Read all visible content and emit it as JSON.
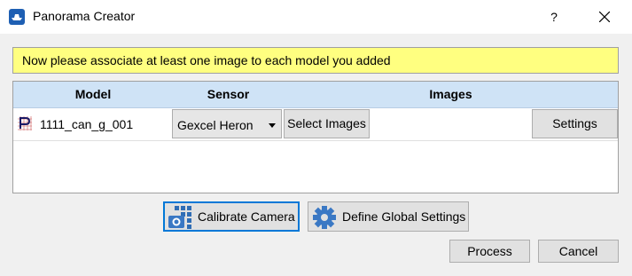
{
  "window": {
    "title": "Panorama Creator",
    "help_label": "?",
    "app_icon": "boat-app-icon",
    "close_icon": "close-icon"
  },
  "banner": {
    "text": "Now please associate at least one image to each model you added",
    "color": "#ffff80"
  },
  "table": {
    "header_color": "#cfe3f6",
    "columns": [
      "Model",
      "Sensor",
      "Images"
    ],
    "rows": [
      {
        "icon": "point-cloud-model-icon",
        "model": "1111_can_g_001",
        "sensor": "Gexcel Heron",
        "select_images_label": "Select Images",
        "settings_label": "Settings"
      }
    ]
  },
  "actions": {
    "calibrate_label": "Calibrate Camera",
    "calibrate_icon": "camera-grid-icon",
    "global_settings_label": "Define Global Settings",
    "global_settings_icon": "gear-icon",
    "process_label": "Process",
    "cancel_label": "Cancel",
    "focus_color": "#0078d7"
  }
}
